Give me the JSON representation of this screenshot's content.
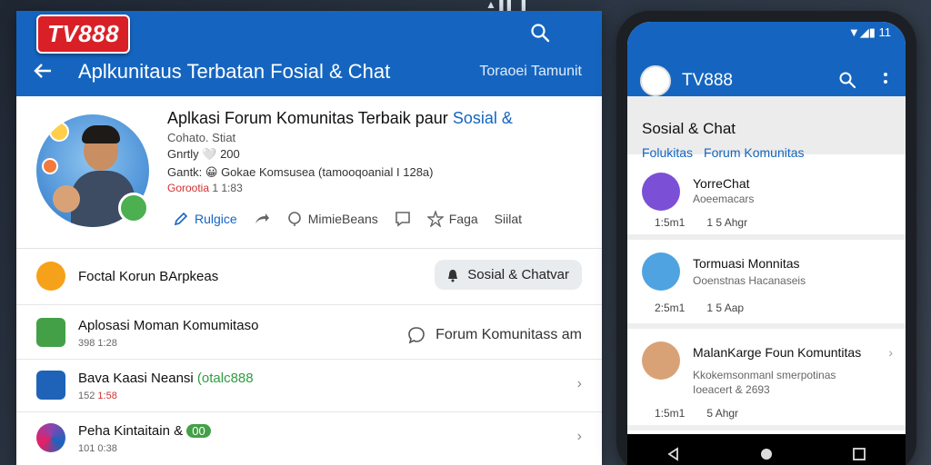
{
  "brand": {
    "logo_text": "TV888",
    "status_fragment": "▲ ▌▌ ▐"
  },
  "desktop": {
    "app_title": "Aplkunitaus Terbatan Fosial & Chat",
    "app_right_link": "Toraoei Tamunit",
    "profile": {
      "title_main": "Aplkasi Forum Komunitas Terbaik paur ",
      "title_highlight": "Sosial &",
      "subtitle": "Cohato. Stiat",
      "line2": "Gnrtly 🤍 200",
      "line3": "Gantk: 😀 Gokae Komsusea (tamooqoanial I 128a)",
      "line4_label": "Gorootia",
      "line4_value": "1 1:83",
      "actions": [
        "Rulgice",
        "",
        "MimieBeans",
        "",
        "Faga",
        "Siilat"
      ]
    },
    "rows": [
      {
        "title": "Foctal Korun BArpkeas",
        "chip": "Sosial & Chatvar"
      },
      {
        "title": "Aplosasi Moman Komumitaso",
        "meta": "398 1:28",
        "link": "Forum Komunitass am"
      },
      {
        "title_start": "Bava Kaasi Neansi ",
        "title_green": "(otalc888",
        "meta_a": "152 ",
        "meta_b": "1:58"
      },
      {
        "title": "Peha Kintaitain & ",
        "badge": "00",
        "meta": "101 0:38"
      }
    ]
  },
  "phone": {
    "status": "▼◢▮ 11",
    "app_title": "TV888",
    "section_title": "Sosial & Chat",
    "section_tabs": [
      "Folukitas",
      "Forum Komunitas"
    ],
    "items": [
      {
        "name": "YorreChat",
        "desc": "Aoeemacars",
        "time": "1:5m1",
        "count": "1 5 Ahgr"
      },
      {
        "name": "Tormuasi Monnitas",
        "desc": "Ooenstnas Hacanaseis",
        "time": "2:5m1",
        "count": "1 5 Aap"
      },
      {
        "name": "MalanKarge Foun Komuntitas",
        "desc": "Kkokemsonmanl smerpotinas",
        "desc2": "Ioeacert & 2693",
        "time": "1:5m1",
        "count": "5 Ahgr"
      }
    ]
  },
  "colors": {
    "primary": "#1565c0",
    "red": "#d92027",
    "green": "#43a047"
  },
  "icons": [
    "search-icon",
    "back-arrow-icon",
    "edit-icon",
    "share-icon",
    "location-icon",
    "chat-icon",
    "star-icon",
    "more-icon"
  ]
}
